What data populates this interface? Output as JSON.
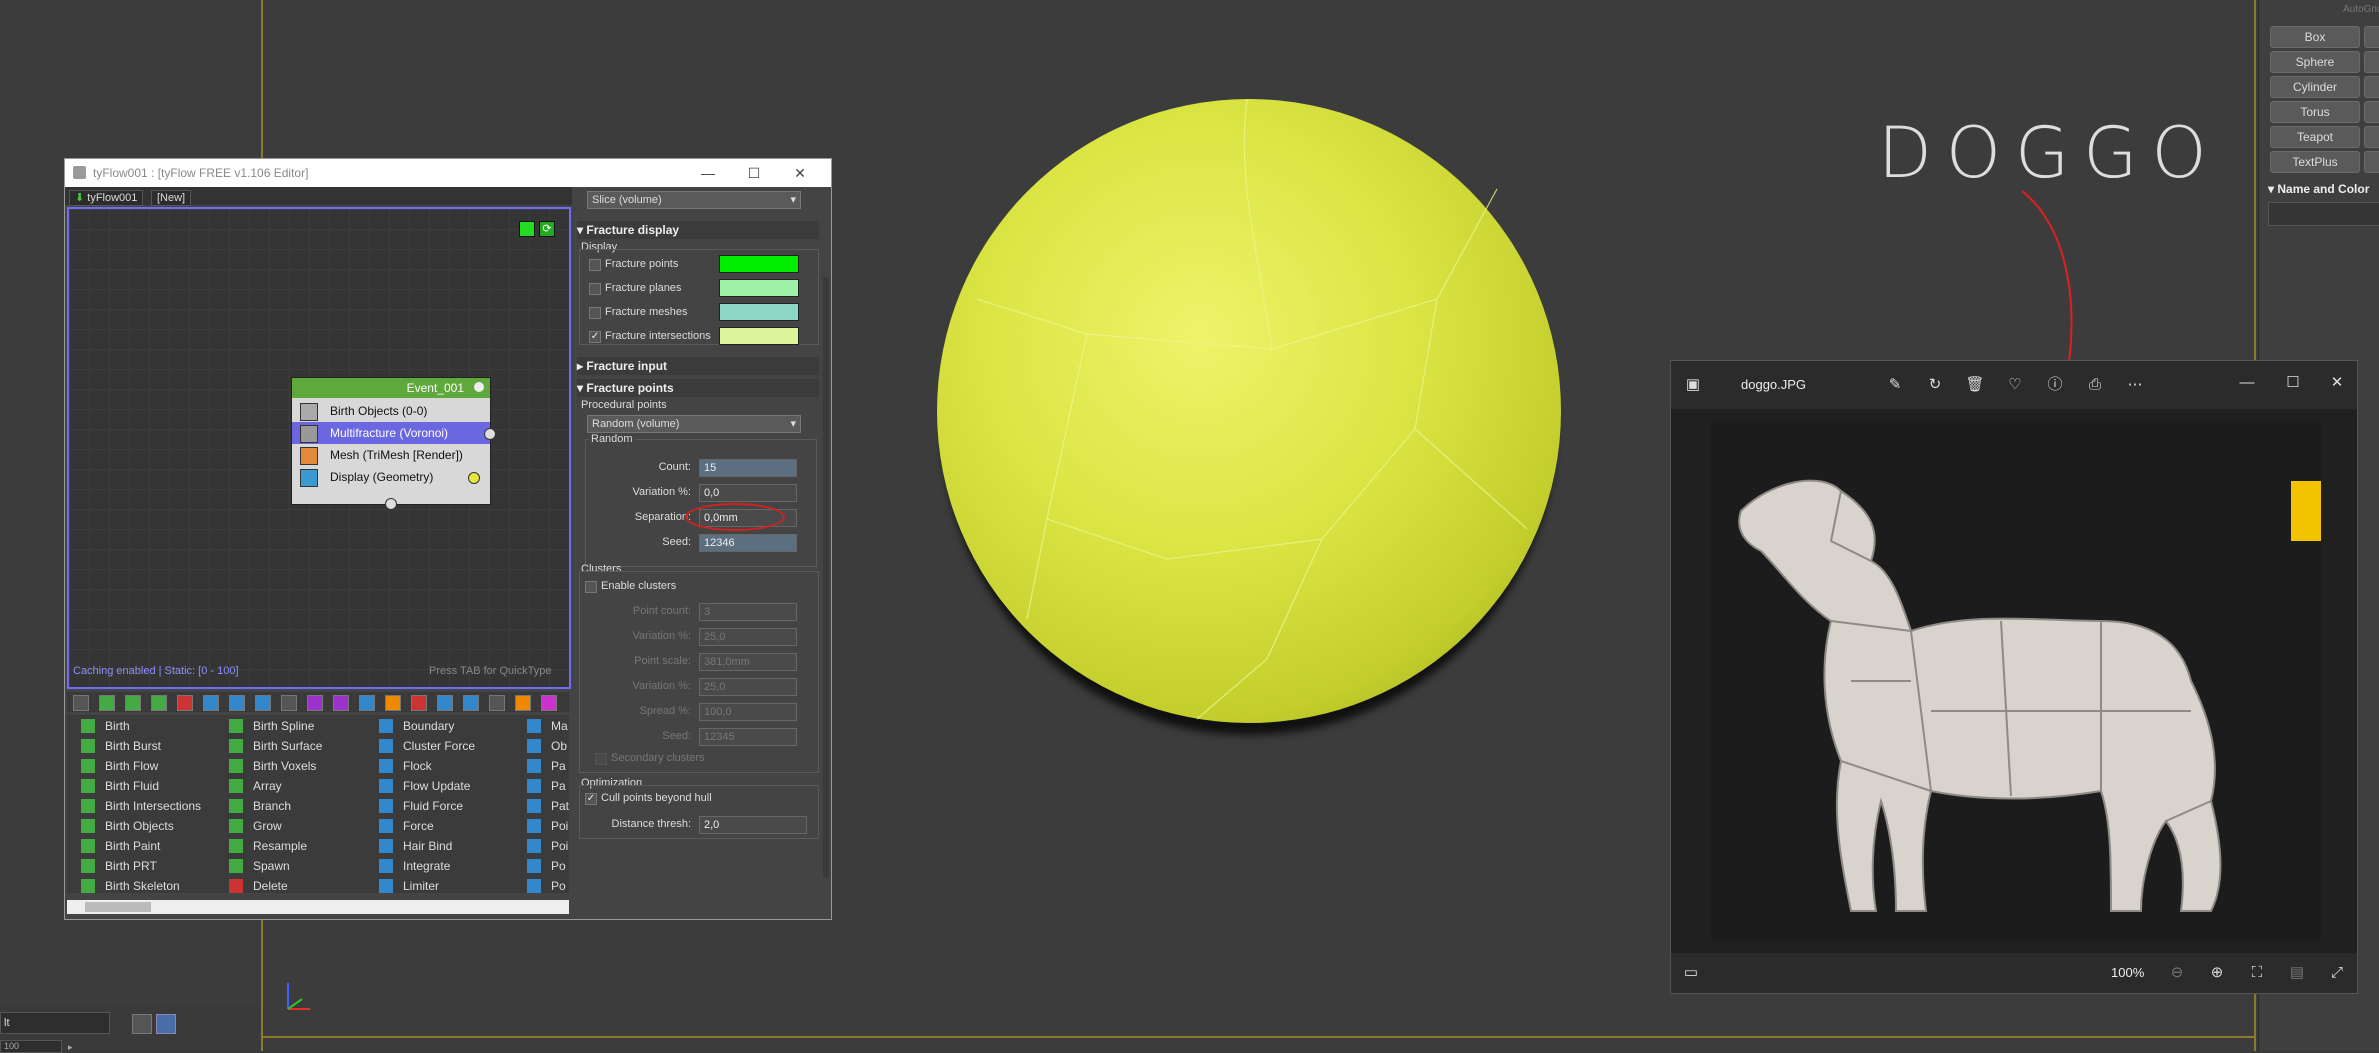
{
  "annotation": {
    "text": "DOGGO",
    "color": "#e02020"
  },
  "command_panel": {
    "buttons": [
      "Box",
      "Sphere",
      "Cylinder",
      "Torus",
      "Teapot",
      "TextPlus"
    ],
    "rollout": "Name and Color",
    "top_label": "AutoGrid"
  },
  "tyflow": {
    "title": "tyFlow001 : [tyFlow FREE v1.106 Editor]",
    "tabs": [
      "tyFlow001",
      "[New]"
    ],
    "event": {
      "name": "Event_001",
      "operators": [
        {
          "label": "Birth Objects (0-0)",
          "selected": false
        },
        {
          "label": "Multifracture (Voronoi)",
          "selected": true
        },
        {
          "label": "Mesh (TriMesh [Render])",
          "selected": false
        },
        {
          "label": "Display (Geometry)",
          "selected": false
        }
      ]
    },
    "status_left": "Caching enabled | Static: [0 - 100]",
    "status_right": "Press TAB for QuickType",
    "operator_list": [
      [
        "Birth",
        "Birth Burst",
        "Birth Flow",
        "Birth Fluid",
        "Birth Intersections",
        "Birth Objects",
        "Birth Paint",
        "Birth PRT",
        "Birth Skeleton"
      ],
      [
        "Birth Spline",
        "Birth Surface",
        "Birth Voxels",
        "Array",
        "Branch",
        "Grow",
        "Resample",
        "Spawn",
        "Delete"
      ],
      [
        "Boundary",
        "Cluster Force",
        "Flock",
        "Flow Update",
        "Fluid Force",
        "Force",
        "Hair Bind",
        "Integrate",
        "Limiter"
      ],
      [
        "Ma",
        "Ob",
        "Pa",
        "Pa",
        "Pat",
        "Poi",
        "Poi",
        "Po",
        "Po"
      ]
    ],
    "props": {
      "top_dropdown": "Slice (volume)",
      "fracture_display": {
        "title": "Fracture display",
        "group": "Display",
        "rows": [
          {
            "label": "Fracture points",
            "checked": false,
            "color": "#00ee00"
          },
          {
            "label": "Fracture planes",
            "checked": false,
            "color": "#9ff0a8"
          },
          {
            "label": "Fracture meshes",
            "checked": false,
            "color": "#8ed6c6"
          },
          {
            "label": "Fracture intersections",
            "checked": true,
            "color": "#dcf59a"
          }
        ]
      },
      "fracture_input": {
        "title": "Fracture input"
      },
      "fracture_points": {
        "title": "Fracture points",
        "procedural_label": "Procedural points",
        "procedural_value": "Random (volume)",
        "random_label": "Random",
        "count_label": "Count:",
        "count": "15",
        "variation_label": "Variation %:",
        "variation": "0,0",
        "separation_label": "Separation:",
        "separation": "0,0mm",
        "seed_label": "Seed:",
        "seed": "12346"
      },
      "clusters": {
        "title": "Clusters",
        "enable_label": "Enable clusters",
        "point_count_label": "Point count:",
        "point_count": "3",
        "variation1_label": "Variation %:",
        "variation1": "25,0",
        "point_scale_label": "Point scale:",
        "point_scale": "381,0mm",
        "variation2_label": "Variation %:",
        "variation2": "25,0",
        "spread_label": "Spread %:",
        "spread": "100,0",
        "seed_label": "Seed:",
        "seed": "12345",
        "secondary_label": "Secondary clusters"
      },
      "optimization": {
        "title": "Optimization",
        "cull_label": "Cull points beyond hull",
        "distance_label": "Distance thresh:",
        "distance": "2,0"
      }
    }
  },
  "photo": {
    "filename": "doggo.JPG",
    "zoom": "100%"
  },
  "bottom": {
    "field_value": "lt",
    "counter": "100"
  }
}
